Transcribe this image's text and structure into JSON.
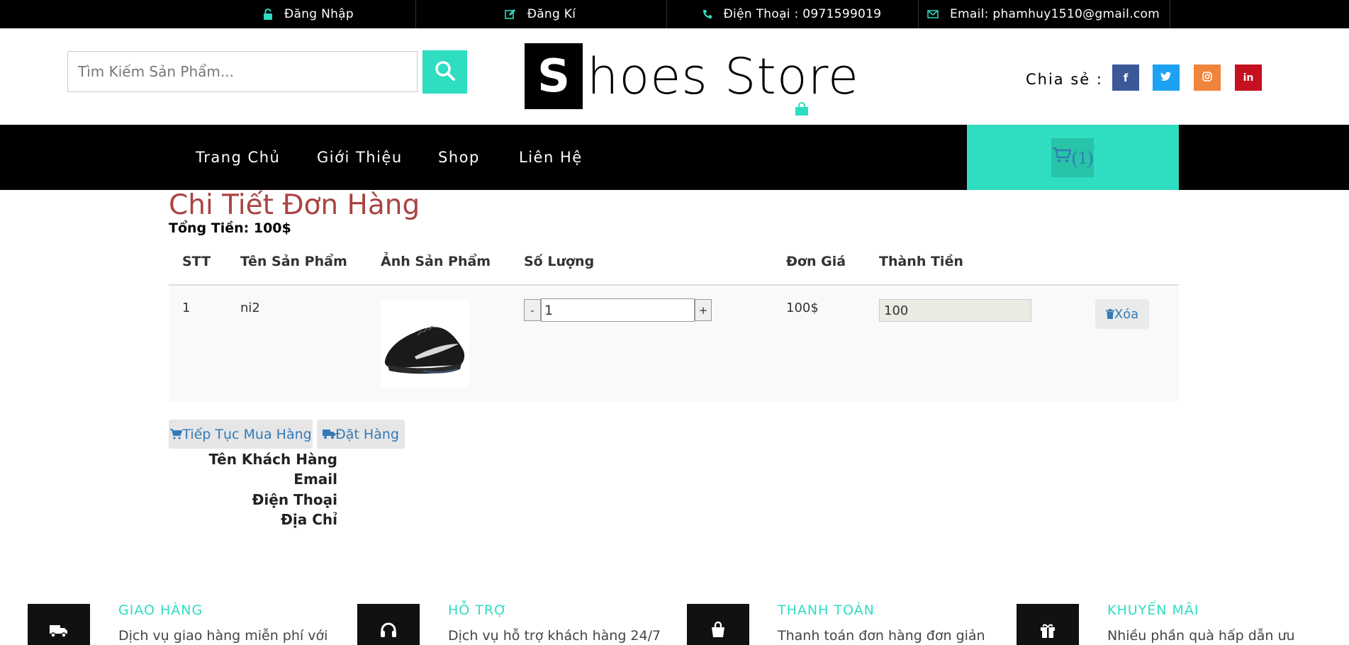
{
  "topbar": {
    "login": "Đăng Nhập",
    "register": "Đăng Kí",
    "phone": "Điện Thoại : 0971599019",
    "email": "Email: phamhuy1510@gmail.com"
  },
  "header": {
    "search_placeholder": "Tìm Kiếm Sản Phẩm...",
    "logo_letter": "S",
    "logo_rest": "hoes Store",
    "share_label": "Chia sẻ :",
    "socials": [
      {
        "name": "facebook",
        "glyph": "f",
        "color": "#3b5998"
      },
      {
        "name": "twitter",
        "glyph": "t",
        "color": "#1da1f2"
      },
      {
        "name": "instagram",
        "glyph": "◎",
        "color": "#f0843c"
      },
      {
        "name": "linkedin",
        "glyph": "in",
        "color": "#c5101f"
      }
    ]
  },
  "nav": {
    "items": [
      "Trang Chủ",
      "Giới Thiệu",
      "Shop",
      "Liên Hệ"
    ],
    "cart_count": "(1)",
    "accent": "#2fddc0"
  },
  "order": {
    "title": "Chi Tiết Đơn Hàng",
    "total": "Tổng Tiền: 100$",
    "columns": [
      "STT",
      "Tên Sản Phẩm",
      "Ảnh Sản Phẩm",
      "Số Lượng",
      "Đơn Giá",
      "Thành Tiền"
    ],
    "rows": [
      {
        "stt": "1",
        "name": "ni2",
        "quantity": "1",
        "unit_price": "100$",
        "line_total": "100",
        "delete_label": "Xóa"
      }
    ],
    "qty_minus": "-",
    "qty_plus": "+"
  },
  "actions": {
    "continue": "Tiếp Tục Mua Hàng",
    "checkout": "Đặt Hàng"
  },
  "customer_form": {
    "labels": [
      "Tên Khách Hàng",
      "Email",
      "Điện Thoại",
      "Địa Chỉ"
    ]
  },
  "features": [
    {
      "title": "GIAO HÀNG",
      "desc": "Dịch vụ giao hàng miễn phí với",
      "icon": "truck-icon"
    },
    {
      "title": "HỖ TRỢ",
      "desc": "Dịch vụ hỗ trợ khách hàng 24/7",
      "icon": "headphones-icon"
    },
    {
      "title": "THANH TOÁN",
      "desc": "Thanh toán đơn hàng đơn giản",
      "icon": "shopping-bag-icon"
    },
    {
      "title": "KHUYẾN MÃI",
      "desc": "Nhiều phần quà hấp dẫn ưu",
      "icon": "gift-icon"
    }
  ]
}
